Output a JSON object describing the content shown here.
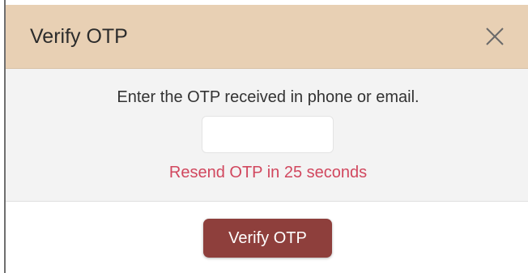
{
  "dialog": {
    "title": "Verify OTP",
    "close_icon": "close-icon",
    "prompt": "Enter the OTP received in phone or email.",
    "otp_input": {
      "value": "",
      "placeholder": ""
    },
    "resend_text": "Resend OTP in 25 seconds",
    "verify_button_label": "Verify OTP"
  },
  "colors": {
    "header_bg": "#e8d0b4",
    "body_bg": "#f3f3f3",
    "resend_text": "#d1475e",
    "verify_button_bg": "#8e3f3c"
  }
}
